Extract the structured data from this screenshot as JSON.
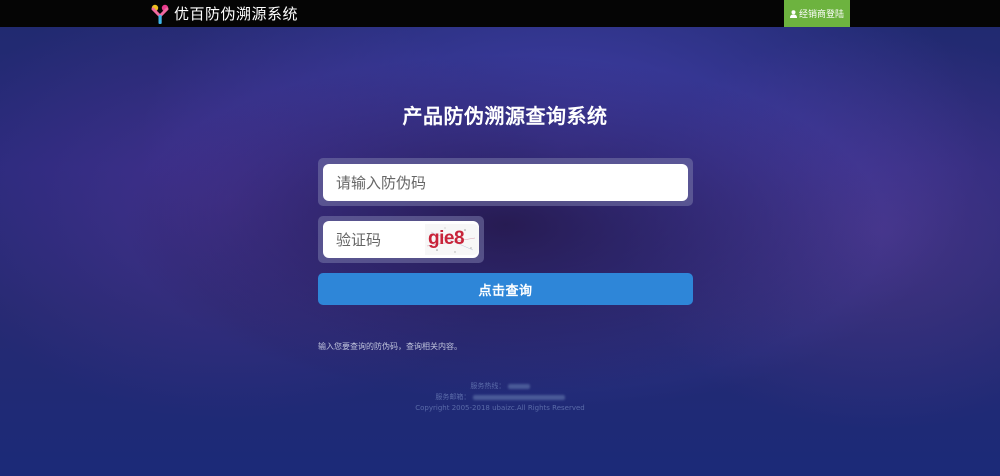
{
  "header": {
    "logo_icon": "y-logo-icon",
    "logo_text": "优百防伪溯源系统",
    "login_label": "经销商登陆",
    "login_icon": "user-icon",
    "login_color": "#6db33f"
  },
  "main": {
    "title": "产品防伪溯源查询系统",
    "code_placeholder": "请输入防伪码",
    "captcha_placeholder": "验证码",
    "captcha_text": "gie8",
    "query_label": "点击查询",
    "query_color": "#2e86d8",
    "hint": "输入您要查询的防伪码，查询相关内容。"
  },
  "footer": {
    "line1": "服务热线：",
    "line2": "服务邮箱：",
    "copyright": "Copyright 2005-2018 ubaizc.All Rights Reserved"
  }
}
